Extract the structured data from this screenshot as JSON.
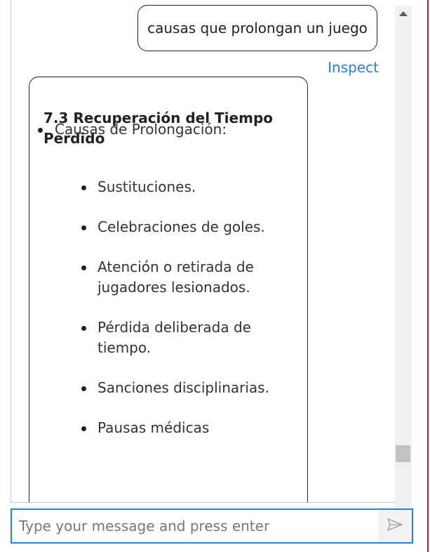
{
  "chat": {
    "user_message": "causas que prolongan un juego",
    "inspect_label": "Inspect",
    "bot_message": {
      "title": "7.3 Recuperación del Tiempo Perdido",
      "outer_item": "Causas de Prolongación:",
      "inner_items": [
        "Sustituciones.",
        "Celebraciones de goles.",
        "Atención o retirada de jugadores lesionados.",
        "Pérdida deliberada de tiempo.",
        "Sanciones disciplinarias.",
        "Pausas médicas"
      ]
    }
  },
  "input": {
    "placeholder": "Type your message and press enter",
    "value": ""
  },
  "icons": {
    "send": "send-icon",
    "scroll_up": "scroll-up-arrow-icon",
    "scroll_down": "scroll-down-arrow-icon"
  },
  "colors": {
    "accent": "#2b7fd4",
    "border_red": "#d51a1a",
    "bubble_border": "#222222"
  },
  "scroll": {
    "position": 0.86
  }
}
